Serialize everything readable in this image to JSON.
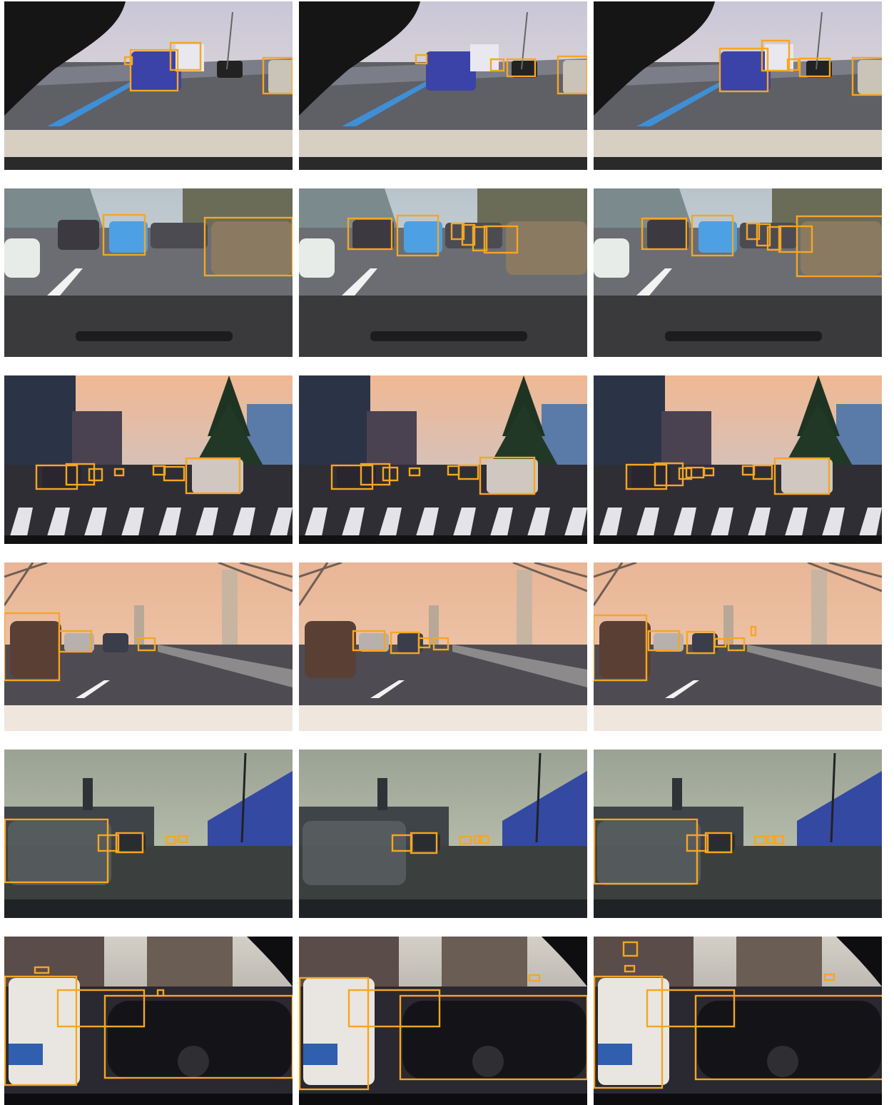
{
  "colors": {
    "box": "#f5a623",
    "background": "#ffffff"
  },
  "rows": [
    {
      "scene": "highway-dusk",
      "panels": [
        {
          "boxes": [
            [
              175,
              80,
              185,
              90
            ],
            [
              183,
              70,
              249,
              127
            ],
            [
              239,
              60,
              281,
              98
            ],
            [
              369,
              81,
              410,
              131
            ]
          ]
        },
        {
          "boxes": [
            [
              583,
              77,
              598,
              89
            ],
            [
              688,
              83,
              706,
              99
            ],
            [
              711,
              83,
              750,
              107
            ],
            [
              782,
              79,
              823,
              131
            ]
          ]
        },
        {
          "boxes": [
            [
              1009,
              68,
              1076,
              128
            ],
            [
              1068,
              57,
              1106,
              99
            ],
            [
              1104,
              83,
              1119,
              98
            ],
            [
              1121,
              82,
              1163,
              107
            ],
            [
              1195,
              81,
              1250,
              133
            ]
          ]
        }
      ]
    },
    {
      "scene": "wet-street-traffic",
      "panels": [
        {
          "boxes": [
            [
              145,
              301,
              203,
              357
            ],
            [
              287,
              305,
              410,
              386
            ]
          ]
        },
        {
          "boxes": [
            [
              488,
              306,
              549,
              349
            ],
            [
              557,
              302,
              614,
              358
            ],
            [
              633,
              313,
              650,
              335
            ],
            [
              648,
              315,
              665,
              343
            ],
            [
              663,
              318,
              682,
              351
            ],
            [
              679,
              317,
              725,
              354
            ]
          ]
        },
        {
          "boxes": [
            [
              900,
              306,
              962,
              349
            ],
            [
              970,
              302,
              1027,
              358
            ],
            [
              1047,
              313,
              1064,
              335
            ],
            [
              1061,
              314,
              1079,
              344
            ],
            [
              1076,
              318,
              1094,
              350
            ],
            [
              1092,
              317,
              1138,
              353
            ],
            [
              1117,
              303,
              1250,
              387
            ]
          ]
        }
      ]
    },
    {
      "scene": "city-street-crosswalk",
      "panels": [
        {
          "boxes": [
            [
              51,
              652,
              108,
              685
            ],
            [
              93,
              650,
              132,
              679
            ],
            [
              125,
              657,
              143,
              673
            ],
            [
              161,
              657,
              173,
              666
            ],
            [
              215,
              653,
              231,
              665
            ],
            [
              230,
              654,
              258,
              673
            ],
            [
              261,
              642,
              336,
              691
            ]
          ]
        },
        {
          "boxes": [
            [
              465,
              652,
              522,
              685
            ],
            [
              506,
              650,
              546,
              679
            ],
            [
              537,
              655,
              557,
              673
            ],
            [
              574,
              656,
              588,
              666
            ],
            [
              628,
              653,
              643,
              665
            ],
            [
              643,
              652,
              670,
              671
            ],
            [
              673,
              641,
              749,
              692
            ]
          ]
        },
        {
          "boxes": [
            [
              878,
              651,
              934,
              685
            ],
            [
              918,
              649,
              957,
              680
            ],
            [
              952,
              656,
              969,
              671
            ],
            [
              962,
              655,
              986,
              669
            ],
            [
              987,
              656,
              1000,
              666
            ],
            [
              1041,
              653,
              1057,
              665
            ],
            [
              1056,
              652,
              1082,
              671
            ],
            [
              1086,
              642,
              1162,
              692
            ]
          ]
        }
      ]
    },
    {
      "scene": "bridge-sunset",
      "panels": [
        {
          "boxes": [
            [
              6,
              859,
              83,
              953
            ],
            [
              83,
              884,
              128,
              913
            ],
            [
              194,
              894,
              217,
              911
            ]
          ]
        },
        {
          "boxes": [
            [
              495,
              884,
              539,
              911
            ],
            [
              548,
              886,
              587,
              915
            ],
            [
              587,
              894,
              602,
              907
            ],
            [
              608,
              894,
              628,
              910
            ]
          ]
        },
        {
          "boxes": [
            [
              832,
              862,
              906,
              953
            ],
            [
              909,
              884,
              952,
              911
            ],
            [
              963,
              885,
              1001,
              915
            ],
            [
              1002,
              895,
              1017,
              906
            ],
            [
              1021,
              894,
              1043,
              911
            ],
            [
              1053,
              878,
              1059,
              890
            ]
          ]
        }
      ]
    },
    {
      "scene": "industrial-street-dusk",
      "panels": [
        {
          "boxes": [
            [
              7,
              1148,
              151,
              1236
            ],
            [
              138,
              1170,
              166,
              1192
            ],
            [
              163,
              1167,
              200,
              1194
            ],
            [
              233,
              1172,
              246,
              1182
            ],
            [
              250,
              1171,
              262,
              1180
            ]
          ]
        },
        {
          "boxes": [
            [
              550,
              1170,
              577,
              1192
            ],
            [
              576,
              1167,
              612,
              1195
            ],
            [
              645,
              1172,
              660,
              1182
            ],
            [
              665,
              1171,
              675,
              1181
            ],
            [
              672,
              1171,
              685,
              1181
            ]
          ]
        },
        {
          "boxes": [
            [
              833,
              1148,
              977,
              1238
            ],
            [
              963,
              1170,
              992,
              1192
            ],
            [
              989,
              1167,
              1025,
              1194
            ],
            [
              1058,
              1172,
              1073,
              1182
            ],
            [
              1076,
              1171,
              1087,
              1181
            ],
            [
              1084,
              1171,
              1098,
              1182
            ]
          ]
        }
      ]
    },
    {
      "scene": "downtown-night-traffic",
      "panels": [
        {
          "boxes": [
            [
              7,
              1368,
              107,
              1520
            ],
            [
              81,
              1387,
              202,
              1438
            ],
            [
              147,
              1395,
              410,
              1510
            ],
            [
              49,
              1355,
              68,
              1363
            ],
            [
              221,
              1387,
              229,
              1395
            ]
          ]
        },
        {
          "boxes": [
            [
              420,
              1370,
              516,
              1526
            ],
            [
              489,
              1387,
              616,
              1438
            ],
            [
              561,
              1395,
              823,
              1512
            ],
            [
              742,
              1366,
              756,
              1374
            ]
          ]
        },
        {
          "boxes": [
            [
              833,
              1368,
              928,
              1524
            ],
            [
              907,
              1387,
              1029,
              1438
            ],
            [
              975,
              1395,
              1250,
              1512
            ],
            [
              874,
              1320,
              893,
              1339
            ],
            [
              876,
              1353,
              889,
              1361
            ],
            [
              1156,
              1365,
              1169,
              1373
            ]
          ]
        }
      ]
    }
  ]
}
